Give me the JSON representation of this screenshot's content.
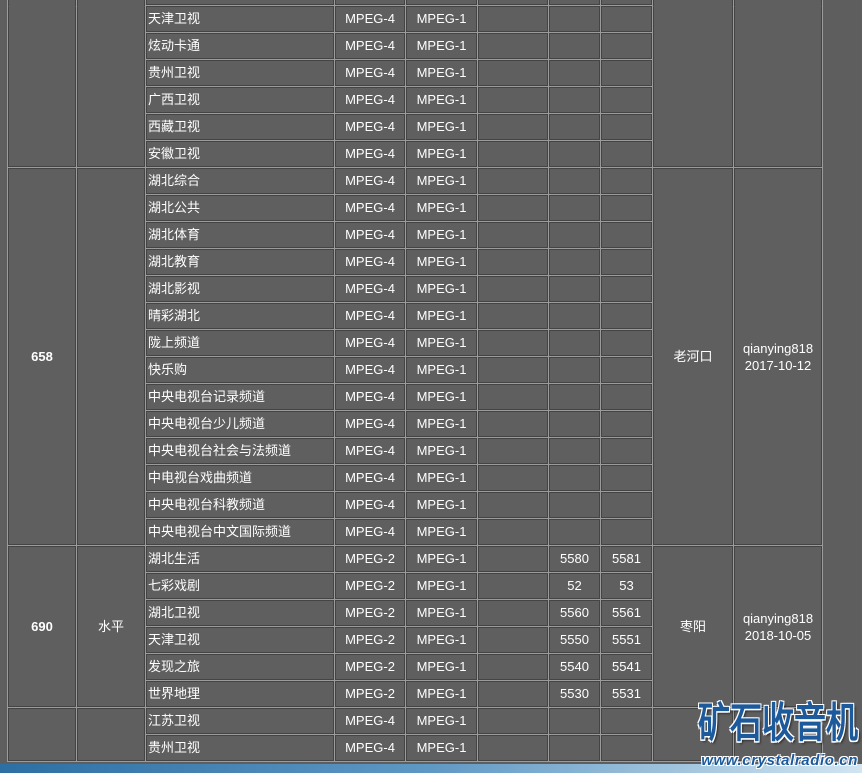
{
  "groups": [
    {
      "rows": [
        {
          "channel": "天津卫视",
          "video": "MPEG-4",
          "audio": "MPEG-1"
        },
        {
          "channel": "炫动卡通",
          "video": "MPEG-4",
          "audio": "MPEG-1"
        },
        {
          "channel": "贵州卫视",
          "video": "MPEG-4",
          "audio": "MPEG-1"
        },
        {
          "channel": "广西卫视",
          "video": "MPEG-4",
          "audio": "MPEG-1"
        },
        {
          "channel": "西藏卫视",
          "video": "MPEG-4",
          "audio": "MPEG-1"
        },
        {
          "channel": "安徽卫视",
          "video": "MPEG-4",
          "audio": "MPEG-1"
        }
      ]
    },
    {
      "frequency": "658",
      "location": "老河口",
      "submitter": "qianying818",
      "date": "2017-10-12",
      "rows": [
        {
          "channel": "湖北综合",
          "video": "MPEG-4",
          "audio": "MPEG-1"
        },
        {
          "channel": "湖北公共",
          "video": "MPEG-4",
          "audio": "MPEG-1"
        },
        {
          "channel": "湖北体育",
          "video": "MPEG-4",
          "audio": "MPEG-1"
        },
        {
          "channel": "湖北教育",
          "video": "MPEG-4",
          "audio": "MPEG-1"
        },
        {
          "channel": "湖北影视",
          "video": "MPEG-4",
          "audio": "MPEG-1"
        },
        {
          "channel": "晴彩湖北",
          "video": "MPEG-4",
          "audio": "MPEG-1"
        },
        {
          "channel": "陇上频道",
          "video": "MPEG-4",
          "audio": "MPEG-1"
        },
        {
          "channel": "快乐购",
          "video": "MPEG-4",
          "audio": "MPEG-1"
        },
        {
          "channel": "中央电视台记录频道",
          "video": "MPEG-4",
          "audio": "MPEG-1"
        },
        {
          "channel": "中央电视台少儿频道",
          "video": "MPEG-4",
          "audio": "MPEG-1"
        },
        {
          "channel": "中央电视台社会与法频道",
          "video": "MPEG-4",
          "audio": "MPEG-1"
        },
        {
          "channel": "中电视台戏曲频道",
          "video": "MPEG-4",
          "audio": "MPEG-1"
        },
        {
          "channel": "中央电视台科教频道",
          "video": "MPEG-4",
          "audio": "MPEG-1"
        },
        {
          "channel": "中央电视台中文国际频道",
          "video": "MPEG-4",
          "audio": "MPEG-1"
        }
      ]
    },
    {
      "frequency": "690",
      "polarization": "水平",
      "location": "枣阳",
      "submitter": "qianying818",
      "date": "2018-10-05",
      "rows": [
        {
          "channel": "湖北生活",
          "video": "MPEG-2",
          "audio": "MPEG-1",
          "num_1": "5580",
          "num_2": "5581"
        },
        {
          "channel": "七彩戏剧",
          "video": "MPEG-2",
          "audio": "MPEG-1",
          "num_1": "52",
          "num_2": "53"
        },
        {
          "channel": "湖北卫视",
          "video": "MPEG-2",
          "audio": "MPEG-1",
          "num_1": "5560",
          "num_2": "5561"
        },
        {
          "channel": "天津卫视",
          "video": "MPEG-2",
          "audio": "MPEG-1",
          "num_1": "5550",
          "num_2": "5551"
        },
        {
          "channel": "发现之旅",
          "video": "MPEG-2",
          "audio": "MPEG-1",
          "num_1": "5540",
          "num_2": "5541"
        },
        {
          "channel": "世界地理",
          "video": "MPEG-2",
          "audio": "MPEG-1",
          "num_1": "5530",
          "num_2": "5531"
        }
      ]
    },
    {
      "rows": [
        {
          "channel": "江苏卫视",
          "video": "MPEG-4",
          "audio": "MPEG-1"
        },
        {
          "channel": "贵州卫视",
          "video": "MPEG-4",
          "audio": "MPEG-1"
        }
      ]
    }
  ],
  "watermark": {
    "logo": "矿石收音机",
    "url": "www.crystalradio.cn"
  },
  "colors": {
    "page_background": "#5e5e5e",
    "cell_background": "#5f5f5f",
    "grid_light": "#9b9b9b",
    "grid_dark": "#444444",
    "text": "#ffffff",
    "watermark_blue": "#1d5a9c"
  }
}
